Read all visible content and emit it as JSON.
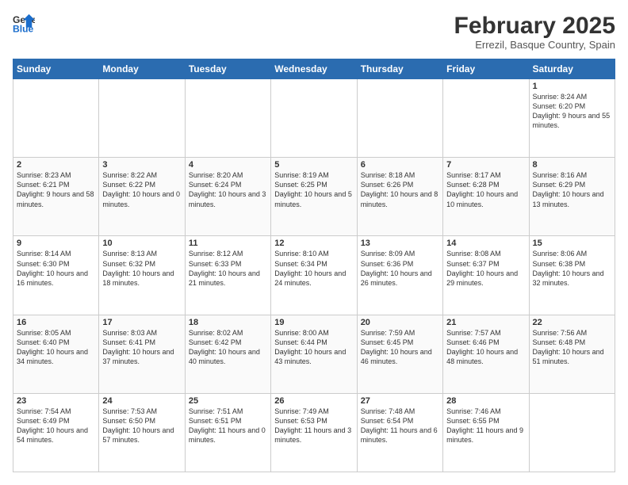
{
  "header": {
    "logo_line1": "General",
    "logo_line2": "Blue",
    "month": "February 2025",
    "location": "Errezil, Basque Country, Spain"
  },
  "weekdays": [
    "Sunday",
    "Monday",
    "Tuesday",
    "Wednesday",
    "Thursday",
    "Friday",
    "Saturday"
  ],
  "weeks": [
    [
      {
        "day": "",
        "info": ""
      },
      {
        "day": "",
        "info": ""
      },
      {
        "day": "",
        "info": ""
      },
      {
        "day": "",
        "info": ""
      },
      {
        "day": "",
        "info": ""
      },
      {
        "day": "",
        "info": ""
      },
      {
        "day": "1",
        "info": "Sunrise: 8:24 AM\nSunset: 6:20 PM\nDaylight: 9 hours and 55 minutes."
      }
    ],
    [
      {
        "day": "2",
        "info": "Sunrise: 8:23 AM\nSunset: 6:21 PM\nDaylight: 9 hours and 58 minutes."
      },
      {
        "day": "3",
        "info": "Sunrise: 8:22 AM\nSunset: 6:22 PM\nDaylight: 10 hours and 0 minutes."
      },
      {
        "day": "4",
        "info": "Sunrise: 8:20 AM\nSunset: 6:24 PM\nDaylight: 10 hours and 3 minutes."
      },
      {
        "day": "5",
        "info": "Sunrise: 8:19 AM\nSunset: 6:25 PM\nDaylight: 10 hours and 5 minutes."
      },
      {
        "day": "6",
        "info": "Sunrise: 8:18 AM\nSunset: 6:26 PM\nDaylight: 10 hours and 8 minutes."
      },
      {
        "day": "7",
        "info": "Sunrise: 8:17 AM\nSunset: 6:28 PM\nDaylight: 10 hours and 10 minutes."
      },
      {
        "day": "8",
        "info": "Sunrise: 8:16 AM\nSunset: 6:29 PM\nDaylight: 10 hours and 13 minutes."
      }
    ],
    [
      {
        "day": "9",
        "info": "Sunrise: 8:14 AM\nSunset: 6:30 PM\nDaylight: 10 hours and 16 minutes."
      },
      {
        "day": "10",
        "info": "Sunrise: 8:13 AM\nSunset: 6:32 PM\nDaylight: 10 hours and 18 minutes."
      },
      {
        "day": "11",
        "info": "Sunrise: 8:12 AM\nSunset: 6:33 PM\nDaylight: 10 hours and 21 minutes."
      },
      {
        "day": "12",
        "info": "Sunrise: 8:10 AM\nSunset: 6:34 PM\nDaylight: 10 hours and 24 minutes."
      },
      {
        "day": "13",
        "info": "Sunrise: 8:09 AM\nSunset: 6:36 PM\nDaylight: 10 hours and 26 minutes."
      },
      {
        "day": "14",
        "info": "Sunrise: 8:08 AM\nSunset: 6:37 PM\nDaylight: 10 hours and 29 minutes."
      },
      {
        "day": "15",
        "info": "Sunrise: 8:06 AM\nSunset: 6:38 PM\nDaylight: 10 hours and 32 minutes."
      }
    ],
    [
      {
        "day": "16",
        "info": "Sunrise: 8:05 AM\nSunset: 6:40 PM\nDaylight: 10 hours and 34 minutes."
      },
      {
        "day": "17",
        "info": "Sunrise: 8:03 AM\nSunset: 6:41 PM\nDaylight: 10 hours and 37 minutes."
      },
      {
        "day": "18",
        "info": "Sunrise: 8:02 AM\nSunset: 6:42 PM\nDaylight: 10 hours and 40 minutes."
      },
      {
        "day": "19",
        "info": "Sunrise: 8:00 AM\nSunset: 6:44 PM\nDaylight: 10 hours and 43 minutes."
      },
      {
        "day": "20",
        "info": "Sunrise: 7:59 AM\nSunset: 6:45 PM\nDaylight: 10 hours and 46 minutes."
      },
      {
        "day": "21",
        "info": "Sunrise: 7:57 AM\nSunset: 6:46 PM\nDaylight: 10 hours and 48 minutes."
      },
      {
        "day": "22",
        "info": "Sunrise: 7:56 AM\nSunset: 6:48 PM\nDaylight: 10 hours and 51 minutes."
      }
    ],
    [
      {
        "day": "23",
        "info": "Sunrise: 7:54 AM\nSunset: 6:49 PM\nDaylight: 10 hours and 54 minutes."
      },
      {
        "day": "24",
        "info": "Sunrise: 7:53 AM\nSunset: 6:50 PM\nDaylight: 10 hours and 57 minutes."
      },
      {
        "day": "25",
        "info": "Sunrise: 7:51 AM\nSunset: 6:51 PM\nDaylight: 11 hours and 0 minutes."
      },
      {
        "day": "26",
        "info": "Sunrise: 7:49 AM\nSunset: 6:53 PM\nDaylight: 11 hours and 3 minutes."
      },
      {
        "day": "27",
        "info": "Sunrise: 7:48 AM\nSunset: 6:54 PM\nDaylight: 11 hours and 6 minutes."
      },
      {
        "day": "28",
        "info": "Sunrise: 7:46 AM\nSunset: 6:55 PM\nDaylight: 11 hours and 9 minutes."
      },
      {
        "day": "",
        "info": ""
      }
    ]
  ]
}
